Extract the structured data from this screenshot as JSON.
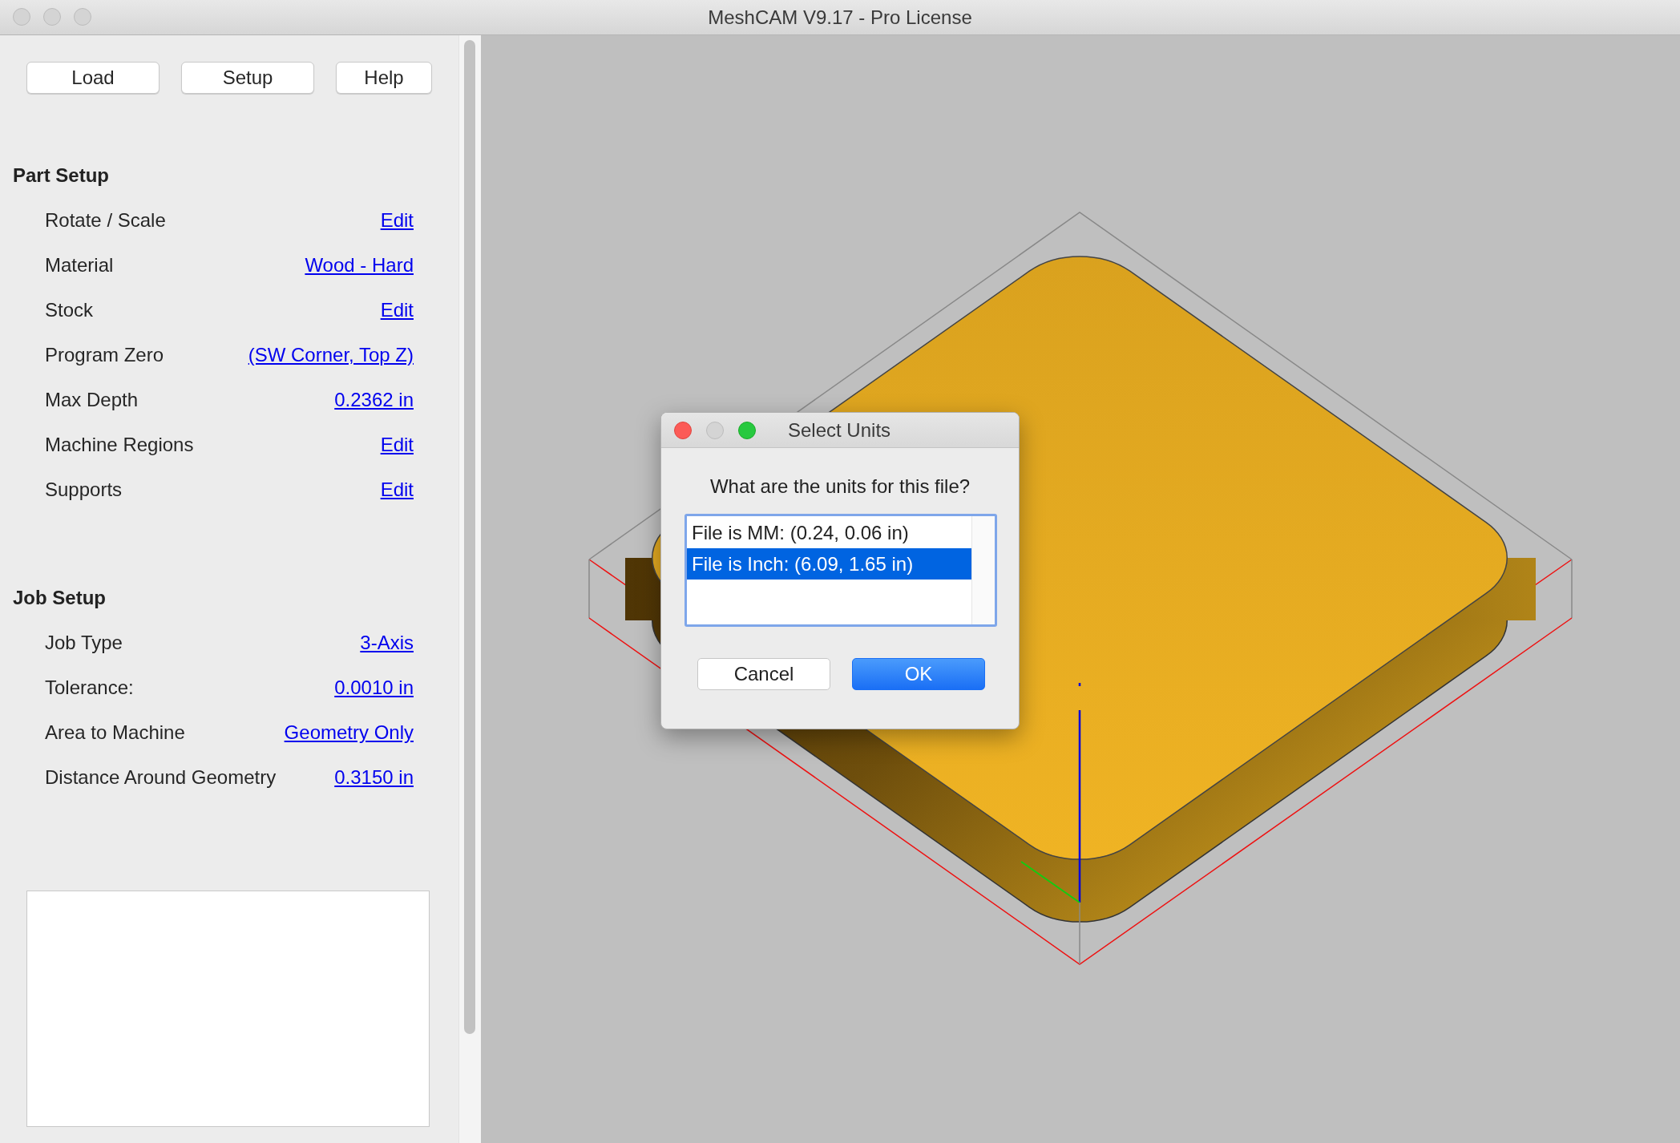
{
  "window": {
    "title": "MeshCAM V9.17 - Pro License"
  },
  "toolbar": [
    {
      "label": "Load"
    },
    {
      "label": "Setup"
    },
    {
      "label": "Help"
    }
  ],
  "sections": [
    {
      "title": "Part Setup",
      "rows": [
        {
          "label": "Rotate / Scale",
          "value": "Edit"
        },
        {
          "label": "Material",
          "value": "Wood - Hard"
        },
        {
          "label": "Stock",
          "value": "Edit"
        },
        {
          "label": "Program Zero",
          "value": "(SW Corner, Top Z)"
        },
        {
          "label": "Max Depth",
          "value": "0.2362 in"
        },
        {
          "label": "Machine Regions",
          "value": "Edit"
        },
        {
          "label": "Supports",
          "value": "Edit"
        }
      ]
    },
    {
      "title": "Job Setup",
      "rows": [
        {
          "label": "Job Type",
          "value": "3-Axis"
        },
        {
          "label": "Tolerance:",
          "value": "0.0010 in"
        },
        {
          "label": "Area to Machine",
          "value": "Geometry Only"
        },
        {
          "label": "Distance Around Geometry",
          "value": "0.3150 in"
        }
      ]
    }
  ],
  "dialog": {
    "title": "Select Units",
    "prompt": "What are the units for this file?",
    "options": [
      {
        "label": "File is MM: (0.24, 0.06 in)",
        "selected": false
      },
      {
        "label": "File is Inch: (6.09, 1.65 in)",
        "selected": true
      }
    ],
    "buttons": [
      {
        "label": "Cancel",
        "kind": "secondary"
      },
      {
        "label": "OK",
        "kind": "primary"
      }
    ]
  }
}
